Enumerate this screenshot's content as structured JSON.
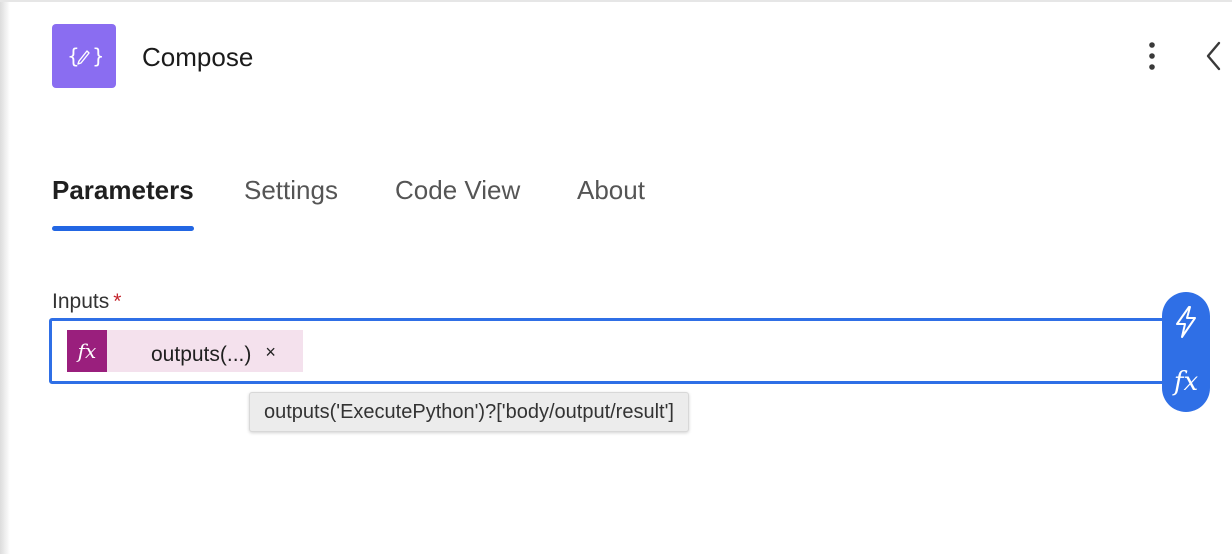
{
  "header": {
    "title": "Compose",
    "action_icon": "compose-braces-icon",
    "more_icon": "more-vertical-icon",
    "collapse_icon": "chevron-left-icon",
    "action_color": "#8a6df1"
  },
  "tabs": [
    {
      "label": "Parameters",
      "active": true
    },
    {
      "label": "Settings",
      "active": false
    },
    {
      "label": "Code View",
      "active": false
    },
    {
      "label": "About",
      "active": false
    }
  ],
  "inputs": {
    "label": "Inputs",
    "required_mark": "*",
    "token": {
      "icon_label": "fx",
      "label": "outputs(...)",
      "remove_glyph": "×"
    },
    "tooltip": "outputs('ExecutePython')?['body/output/result']",
    "tools": {
      "dynamic_content_icon": "lightning-icon",
      "expression_label": "fx"
    }
  },
  "colors": {
    "accent": "#2f6fe6",
    "token_bg": "#f4e1ed",
    "token_icon_bg": "#9a1f7d"
  }
}
